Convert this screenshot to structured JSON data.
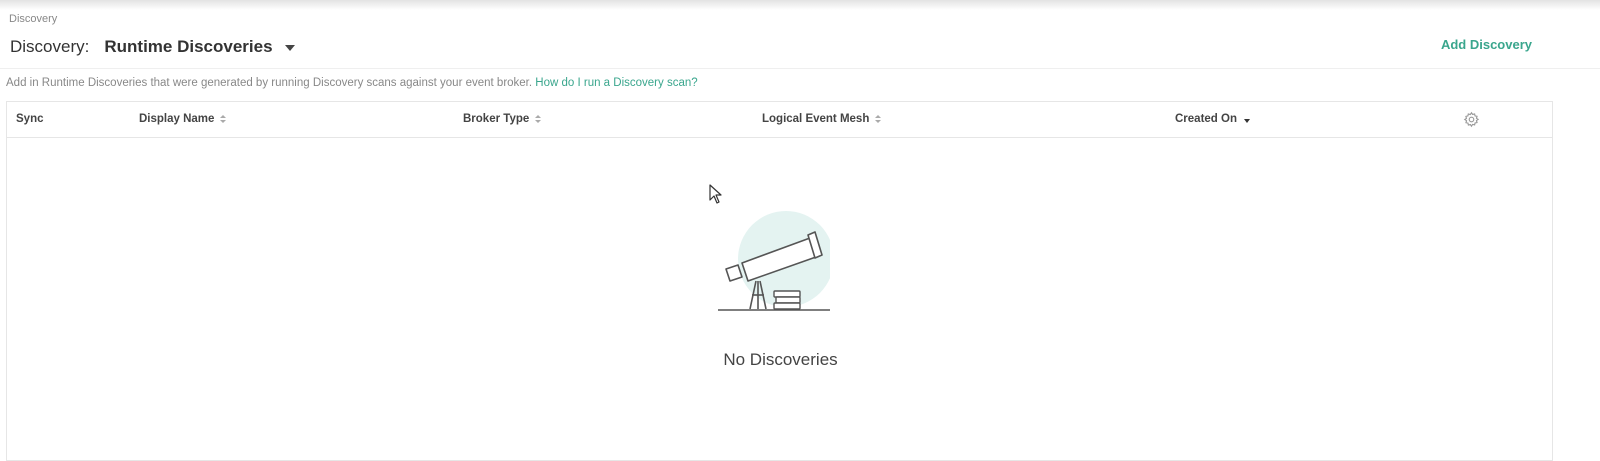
{
  "breadcrumb": "Discovery",
  "header": {
    "label": "Discovery:",
    "selected_view": "Runtime Discoveries",
    "add_button": "Add Discovery"
  },
  "description": {
    "text": "Add in Runtime Discoveries that were generated by running Discovery scans against your event broker.",
    "link": "How do I run a Discovery scan?"
  },
  "table": {
    "columns": [
      {
        "label": "Sync",
        "sort": "none"
      },
      {
        "label": "Display Name",
        "sort": "sortable"
      },
      {
        "label": "Broker Type",
        "sort": "sortable"
      },
      {
        "label": "Logical Event Mesh",
        "sort": "sortable"
      },
      {
        "label": "Created On",
        "sort": "descending"
      }
    ],
    "settings_icon": "gear-icon",
    "empty_state": {
      "icon": "telescope-icon",
      "text": "No Discoveries"
    }
  },
  "colors": {
    "accent": "#3aa68d",
    "illustration_circle": "#e4f3f1"
  }
}
